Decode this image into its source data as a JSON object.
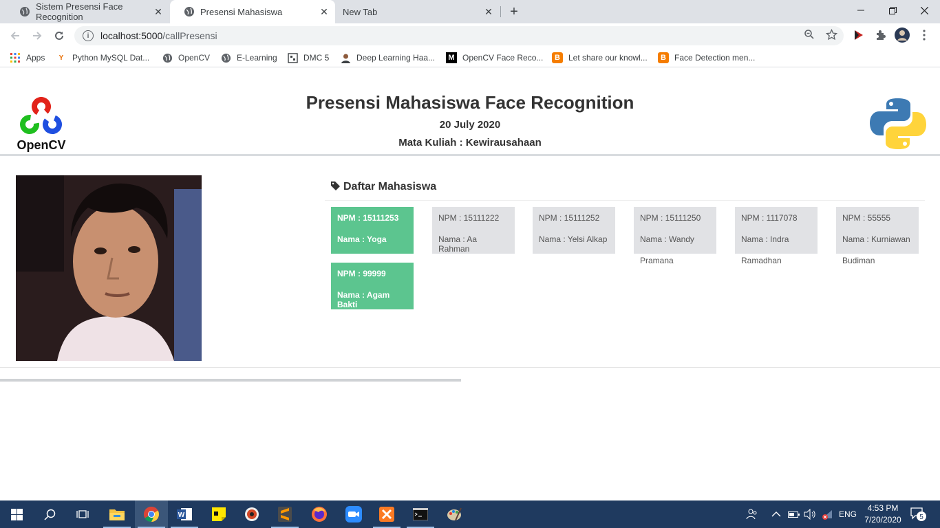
{
  "browser": {
    "tabs": [
      {
        "label": "Sistem Presensi Face Recognition",
        "active": false
      },
      {
        "label": "Presensi Mahasiswa",
        "active": true
      },
      {
        "label": "New Tab",
        "active": false
      }
    ],
    "address": {
      "host": "localhost:5000",
      "path": "/callPresensi"
    },
    "bookmarks": [
      {
        "label": "Apps",
        "icon": "apps-grid-icon"
      },
      {
        "label": "Python MySQL Dat...",
        "icon": "python-mysql-icon"
      },
      {
        "label": "OpenCV",
        "icon": "globe-icon"
      },
      {
        "label": "E-Learning",
        "icon": "globe-icon"
      },
      {
        "label": "DMC 5",
        "icon": "dmc-icon"
      },
      {
        "label": "Deep Learning Haa...",
        "icon": "person-icon"
      },
      {
        "label": "OpenCV Face Reco...",
        "icon": "medium-icon"
      },
      {
        "label": "Let share our knowl...",
        "icon": "blogger-icon"
      },
      {
        "label": "Face Detection men...",
        "icon": "blogger-icon"
      }
    ]
  },
  "header": {
    "title": "Presensi Mahasiswa Face Recognition",
    "date": "20 July 2020",
    "course": "Mata Kuliah : Kewirausahaan",
    "left_logo_text": "OpenCV"
  },
  "list": {
    "title": "Daftar Mahasiswa",
    "students": [
      {
        "npm": "NPM : 15111253",
        "nama": "Nama : Yoga",
        "present": true
      },
      {
        "npm": "NPM : 15111222",
        "nama": "Nama : Aa Rahman",
        "present": false
      },
      {
        "npm": "NPM : 15111252",
        "nama": "Nama : Yelsi Alkap",
        "present": false
      },
      {
        "npm": "NPM : 15111250",
        "nama": "Nama : Wandy",
        "nama_cont": "Pramana",
        "present": false
      },
      {
        "npm": "NPM : 1117078",
        "nama": "Nama : Indra",
        "nama_cont": "Ramadhan",
        "present": false
      },
      {
        "npm": "NPM : 55555",
        "nama": "Nama : Kurniawan",
        "nama_cont": "Budiman",
        "present": false
      },
      {
        "npm": "NPM : 99999",
        "nama": "Nama : Agam Bakti",
        "present": true
      }
    ]
  },
  "taskbar": {
    "language": "ENG",
    "time": "4:53 PM",
    "date": "7/20/2020",
    "notifications": "5"
  },
  "colors": {
    "present": "#5cc58f",
    "absent": "#e1e2e5",
    "taskbar": "#1f3a5f"
  }
}
